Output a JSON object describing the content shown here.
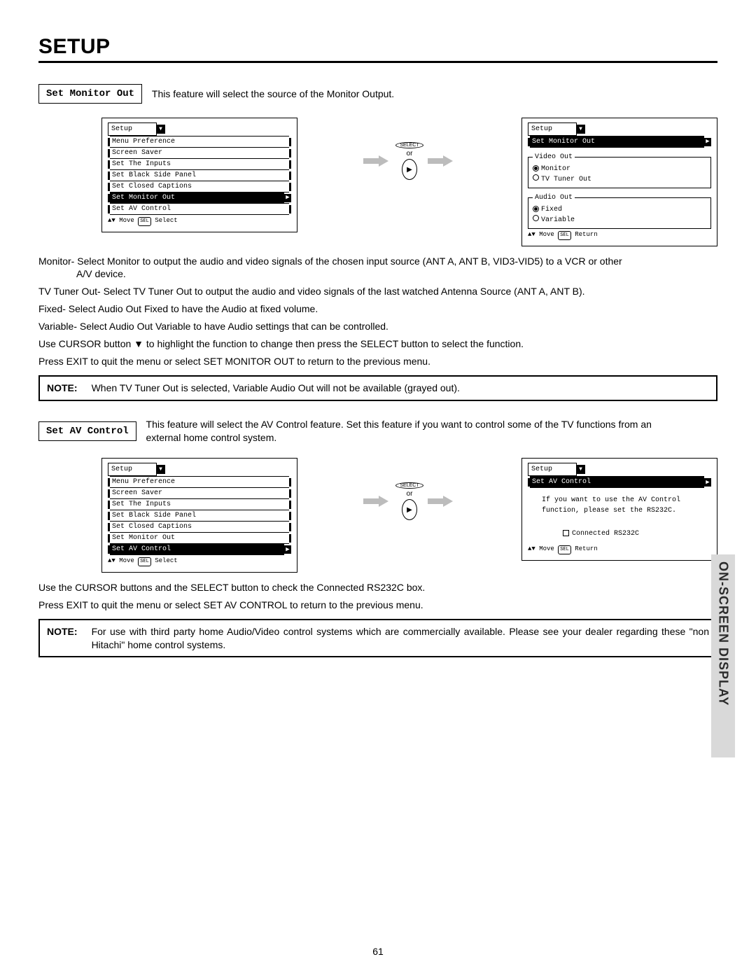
{
  "page_title": "SETUP",
  "side_tab": "ON-SCREEN DISPLAY",
  "page_number": "61",
  "section1": {
    "label": "Set Monitor Out",
    "desc": "This feature will select the source of the Monitor Output.",
    "menu1": {
      "title": "Setup",
      "items": [
        "Menu Preference",
        "Screen Saver",
        "Set The Inputs",
        "Set Black Side Panel",
        "Set Closed Captions",
        "Set Monitor Out",
        "Set AV Control"
      ],
      "selected_index": 5,
      "hint_prefix": "Move",
      "hint_select": "Select"
    },
    "arrow": {
      "select_label": "SELECT",
      "or": "or"
    },
    "menu2": {
      "title": "Setup",
      "crumb": "Set Monitor Out",
      "group1": {
        "legend": "Video Out",
        "opts": [
          "Monitor",
          "TV Tuner Out"
        ],
        "checked": 0
      },
      "group2": {
        "legend": "Audio Out",
        "opts": [
          "Fixed",
          "Variable"
        ],
        "checked": 0
      },
      "hint_prefix": "Move",
      "hint_return": "Return"
    },
    "body": {
      "p1": "Monitor- Select Monitor to output the audio and video signals of the chosen input source (ANT A, ANT B, VID3-VID5) to a VCR or other A/V device.",
      "p2": "TV Tuner Out- Select TV Tuner Out to output the audio and video signals of the last watched Antenna Source (ANT A, ANT B).",
      "p3": "Fixed-  Select Audio Out Fixed to have the Audio at fixed volume.",
      "p4": "Variable- Select Audio Out Variable to have Audio settings that can be controlled.",
      "p5": "Use CURSOR button ▼ to highlight the function to change then press the SELECT button to select the function.",
      "p6": "Press EXIT to quit the menu or select SET MONITOR OUT to return to the previous menu."
    },
    "note": {
      "label": "NOTE:",
      "body": "When TV Tuner Out is selected, Variable Audio Out will not be available (grayed out)."
    }
  },
  "section2": {
    "label": "Set AV Control",
    "desc": "This feature will select the AV Control feature.  Set this feature if you want to control some of the TV functions from an external home control system.",
    "menu1": {
      "title": "Setup",
      "items": [
        "Menu Preference",
        "Screen Saver",
        "Set The Inputs",
        "Set Black Side Panel",
        "Set Closed Captions",
        "Set Monitor Out",
        "Set AV Control"
      ],
      "selected_index": 6,
      "hint_prefix": "Move",
      "hint_select": "Select"
    },
    "arrow": {
      "select_label": "SELECT",
      "or": "or"
    },
    "menu2": {
      "title": "Setup",
      "crumb": "Set AV Control",
      "msg_l1": "If you want to use the AV Control",
      "msg_l2": "function, please set the RS232C.",
      "checkbox_label": "Connected RS232C",
      "hint_prefix": "Move",
      "hint_return": "Return"
    },
    "body": {
      "p1": "Use the CURSOR buttons and the SELECT button to check the Connected RS232C box.",
      "p2": "Press EXIT to quit the menu or select SET AV CONTROL to return to the previous menu."
    },
    "note": {
      "label": "NOTE:",
      "body": "For use with third party home Audio/Video control systems which are commercially available.  Please see your dealer regarding these \"non Hitachi\" home control systems."
    }
  }
}
